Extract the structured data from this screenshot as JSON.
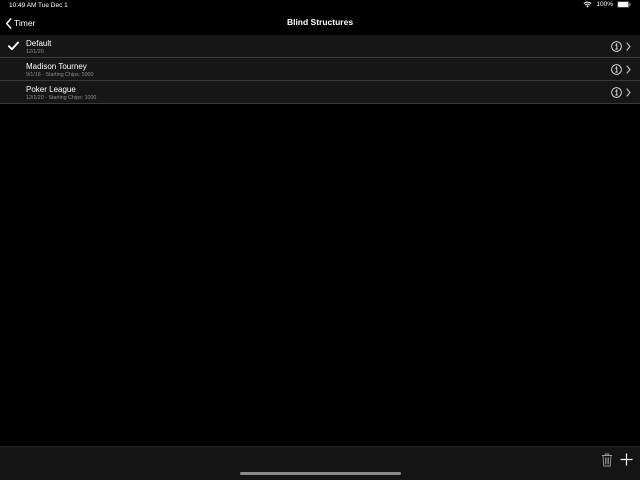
{
  "status_bar": {
    "time": "10:49 AM",
    "date": "Tue Dec 1",
    "battery": "100%",
    "icons": [
      "wifi-icon",
      "battery-icon"
    ]
  },
  "nav": {
    "back_label": "Timer",
    "title": "Blind Structures"
  },
  "structures": [
    {
      "name": "Default",
      "subtitle": "12/1/20",
      "selected": true
    },
    {
      "name": "Madison Tourney",
      "subtitle": "9/1/18 - Starting Chips: 5000",
      "selected": false
    },
    {
      "name": "Poker League",
      "subtitle": "12/1/20 - Starting Chips: 1000",
      "selected": false
    }
  ],
  "toolbar": {
    "icons": [
      "trash-icon",
      "plus-icon"
    ]
  },
  "colors": {
    "background": "#000000",
    "row_background": "#161616",
    "separator": "#3a3a3a",
    "secondary_text": "#8e8e93",
    "toolbar_background": "#141414"
  }
}
